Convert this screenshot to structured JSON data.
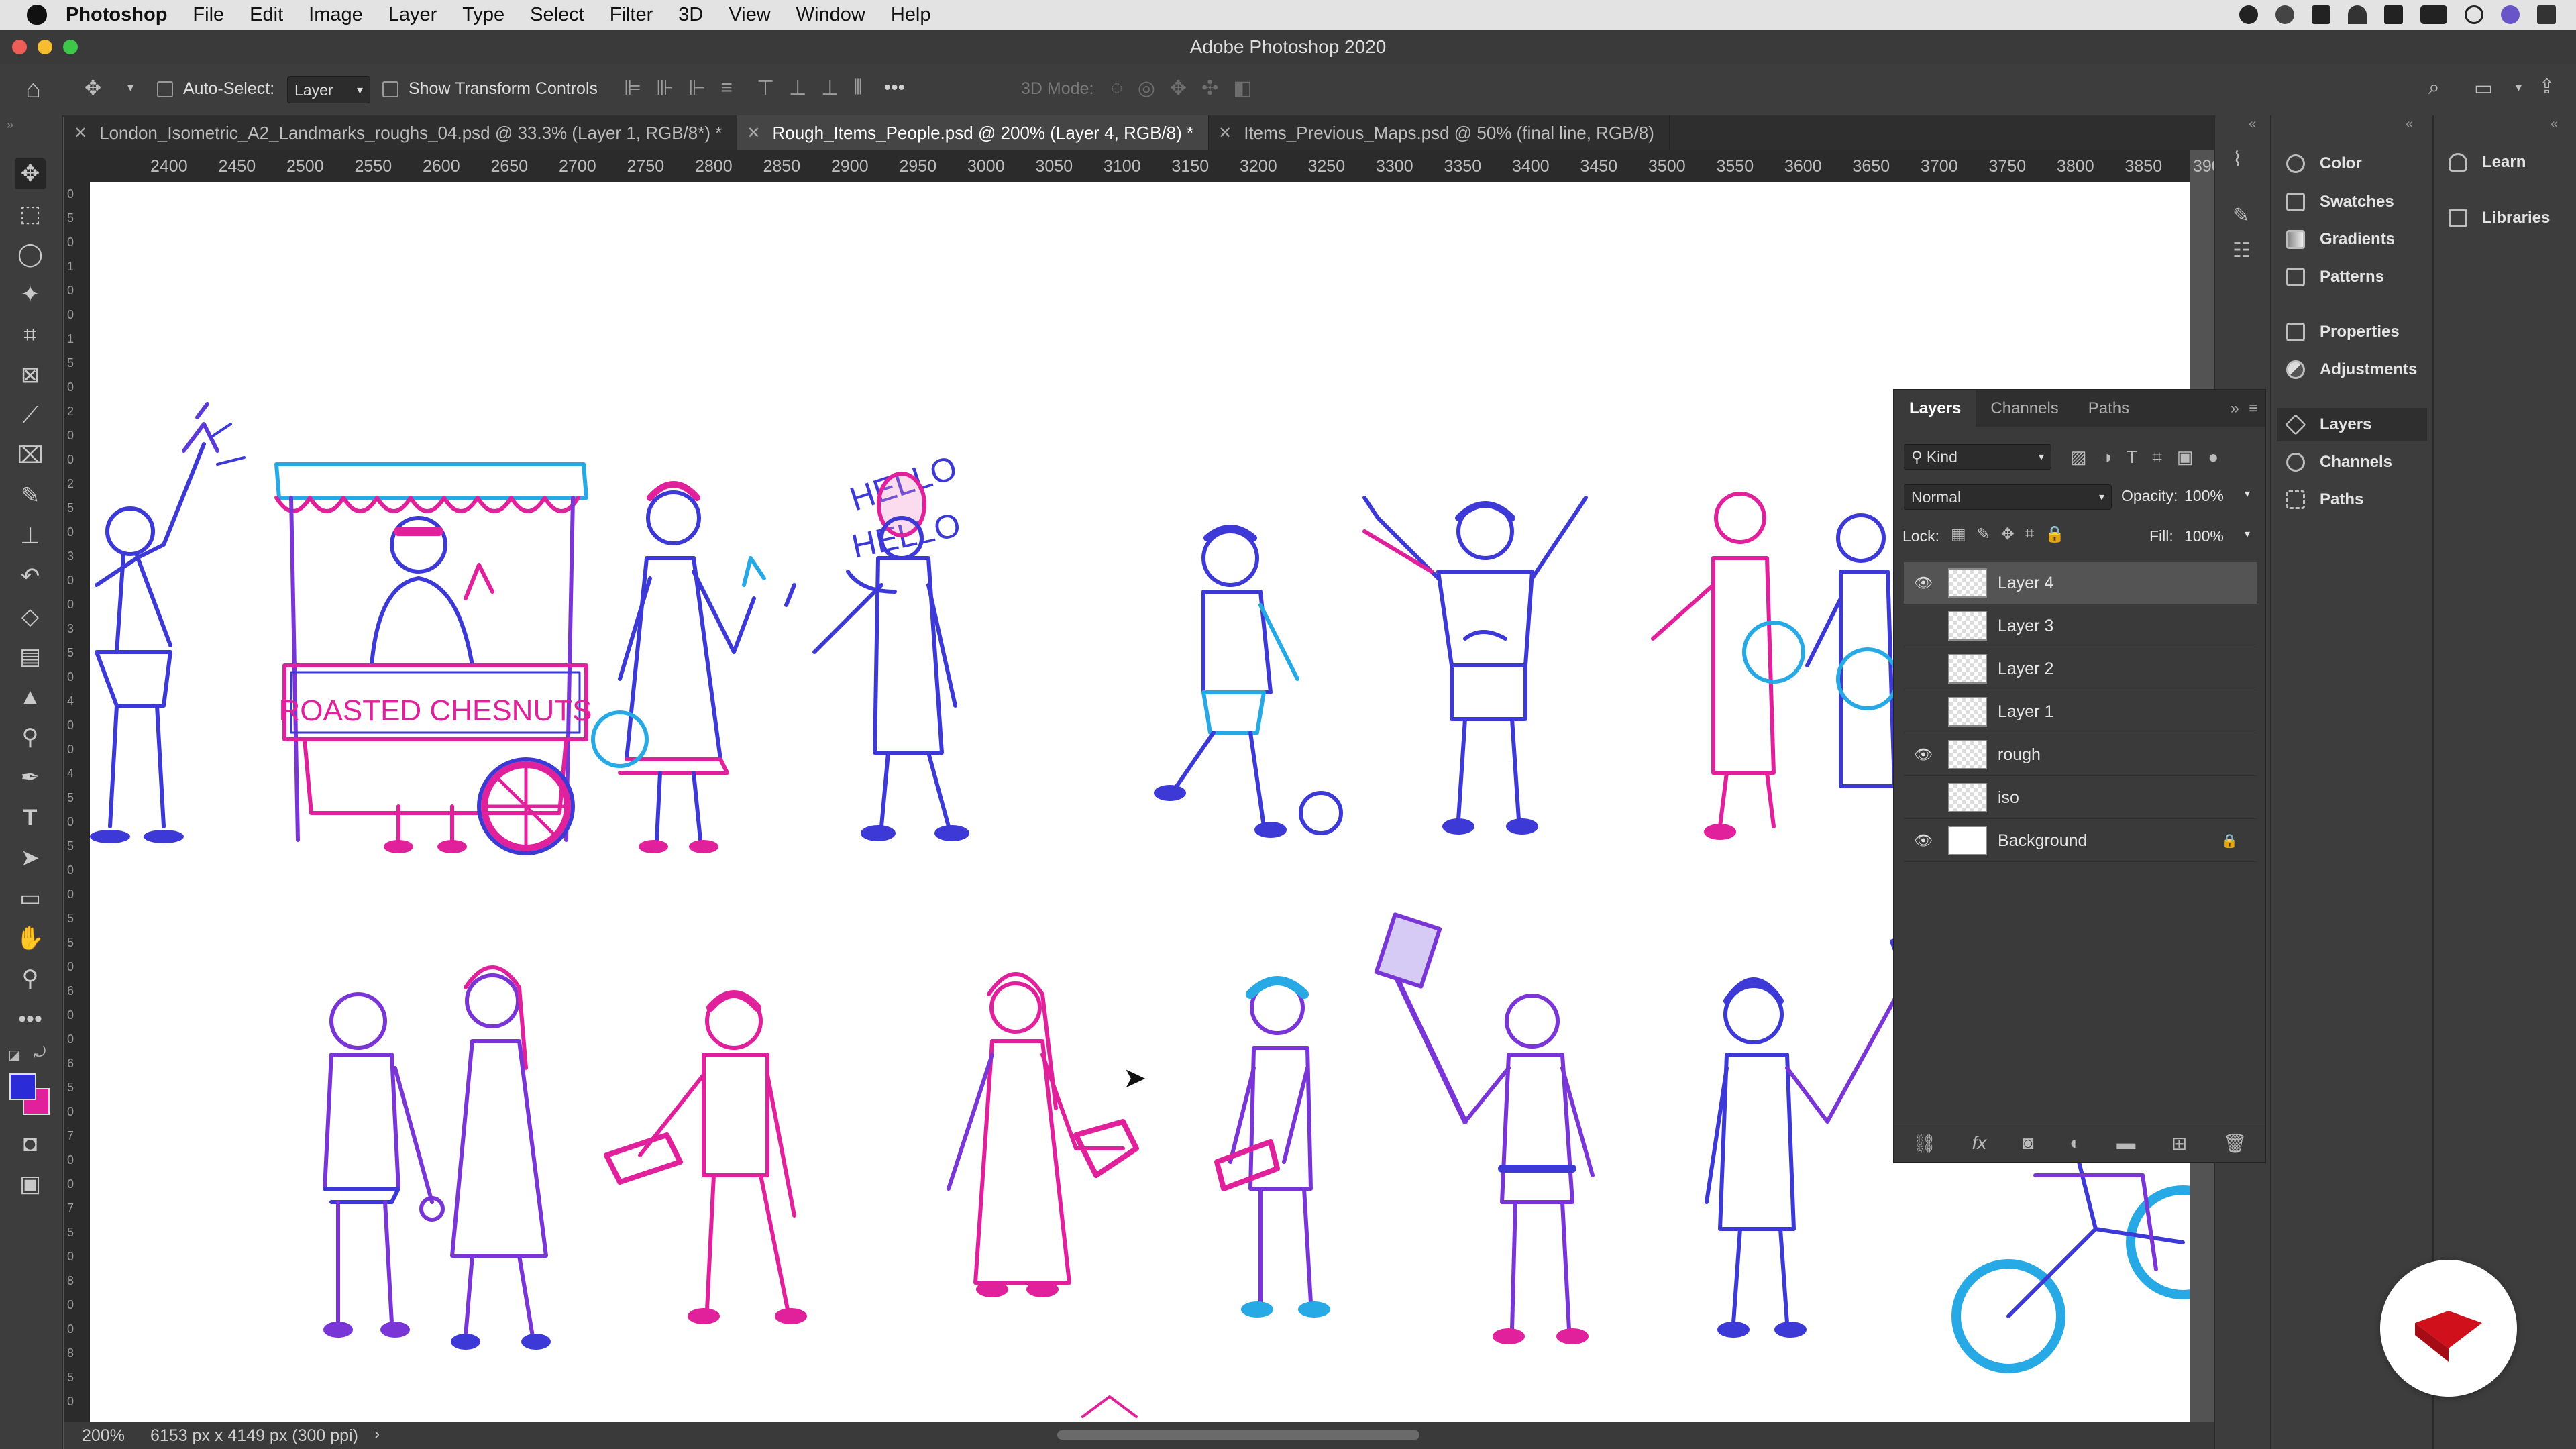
{
  "menubar": {
    "app": "Photoshop",
    "items": [
      "File",
      "Edit",
      "Image",
      "Layer",
      "Type",
      "Select",
      "Filter",
      "3D",
      "View",
      "Window",
      "Help"
    ]
  },
  "window": {
    "title": "Adobe Photoshop 2020"
  },
  "options": {
    "auto_select_label": "Auto-Select:",
    "auto_select_value": "Layer",
    "transform_label": "Show Transform Controls",
    "mode_3d_label": "3D Mode:"
  },
  "tabs": [
    {
      "label": "London_Isometric_A2_Landmarks_roughs_04.psd @ 33.3% (Layer 1, RGB/8*) *"
    },
    {
      "label": "Rough_Items_People.psd @ 200% (Layer 4, RGB/8) *"
    },
    {
      "label": "Items_Previous_Maps.psd @ 50% (final line, RGB/8)"
    }
  ],
  "ruler": {
    "h": [
      "2400",
      "2450",
      "2500",
      "2550",
      "2600",
      "2650",
      "2700",
      "2750",
      "2800",
      "2850",
      "2900",
      "2950",
      "3000",
      "3050",
      "3100",
      "3150",
      "3200",
      "3250",
      "3300",
      "3350",
      "3400",
      "3450",
      "3500",
      "3550",
      "3600",
      "3650",
      "3700",
      "3750",
      "3800",
      "3850",
      "390"
    ],
    "v": [
      "0",
      "5",
      "0",
      "1",
      "0",
      "0",
      "1",
      "5",
      "0",
      "2",
      "0",
      "0",
      "2",
      "5",
      "0",
      "3",
      "0",
      "0",
      "3",
      "5",
      "0",
      "4",
      "0",
      "0",
      "4",
      "5",
      "0",
      "5",
      "0",
      "0",
      "5",
      "5",
      "0",
      "6",
      "0",
      "0",
      "6",
      "5",
      "0",
      "7",
      "0",
      "0",
      "7",
      "5",
      "0",
      "8",
      "0",
      "0",
      "8",
      "5",
      "0"
    ]
  },
  "canvas": {
    "sign_text": "ROASTED CHESNUTS",
    "speech_1": "HELLO",
    "speech_2": "HELLO"
  },
  "status": {
    "zoom": "200%",
    "doc_size": "6153 px x 4149 px (300 ppi)"
  },
  "dock_panels": [
    "Color",
    "Swatches",
    "Gradients",
    "Patterns",
    "Properties",
    "Adjustments",
    "Layers",
    "Channels",
    "Paths"
  ],
  "dock_panels_right": [
    "Learn",
    "Libraries"
  ],
  "layers_panel": {
    "tabs": [
      "Layers",
      "Channels",
      "Paths"
    ],
    "filter": "Kind",
    "blend_mode": "Normal",
    "opacity_label": "Opacity:",
    "opacity": "100%",
    "lock_label": "Lock:",
    "fill_label": "Fill:",
    "fill": "100%",
    "layers": [
      {
        "name": "Layer 4",
        "visible": true,
        "selected": true
      },
      {
        "name": "Layer 3",
        "visible": false
      },
      {
        "name": "Layer 2",
        "visible": false
      },
      {
        "name": "Layer 1",
        "visible": false
      },
      {
        "name": "rough",
        "visible": true
      },
      {
        "name": "iso",
        "visible": false
      },
      {
        "name": "Background",
        "visible": true,
        "locked": true
      }
    ]
  },
  "colors": {
    "accent_magenta": "#e0219b",
    "accent_blue": "#3c39d6",
    "accent_cyan": "#27a9e6",
    "foreground": "#2b2bd8",
    "background_swatch": "#e0219b",
    "brand_red": "#d0101b"
  }
}
